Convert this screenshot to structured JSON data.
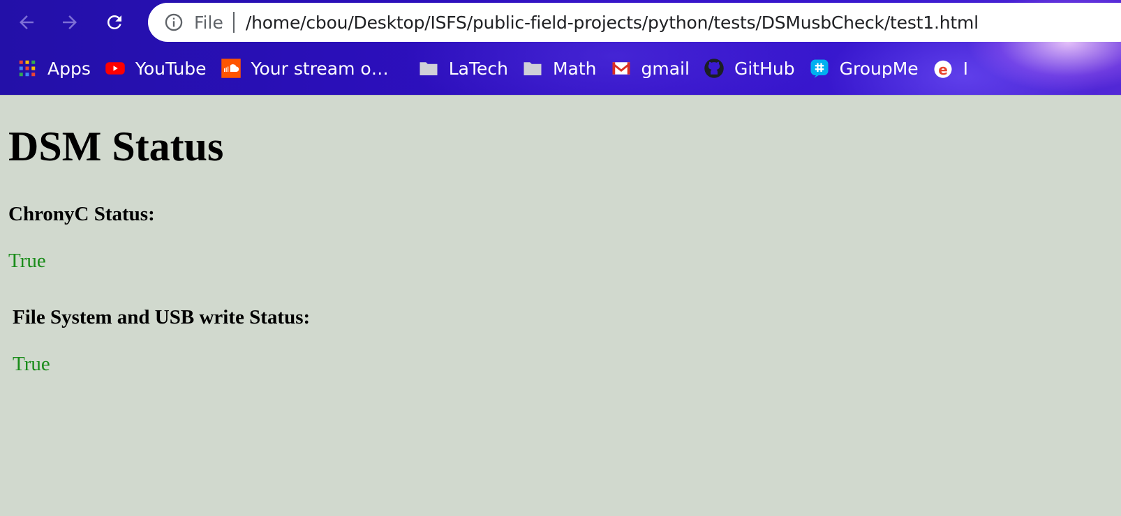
{
  "browser": {
    "back_icon": "arrow-left-icon",
    "forward_icon": "arrow-right-icon",
    "reload_icon": "reload-icon",
    "omnibox": {
      "info_icon": "info-icon",
      "scheme_label": "File",
      "url": "/home/cbou/Desktop/ISFS/public-field-projects/python/tests/DSMusbCheck/test1.html"
    },
    "bookmarks": [
      {
        "label": "Apps",
        "icon": "apps-grid-icon"
      },
      {
        "label": "YouTube",
        "icon": "youtube-icon"
      },
      {
        "label": "Your stream o…",
        "icon": "soundcloud-icon"
      },
      {
        "label": "LaTech",
        "icon": "folder-icon"
      },
      {
        "label": "Math",
        "icon": "folder-icon"
      },
      {
        "label": "gmail",
        "icon": "gmail-icon"
      },
      {
        "label": "GitHub",
        "icon": "github-icon"
      },
      {
        "label": "GroupMe",
        "icon": "groupme-icon"
      },
      {
        "label": "I",
        "icon": "edge-e-icon"
      }
    ]
  },
  "page": {
    "title": "DSM Status",
    "sections": [
      {
        "heading": "ChronyC Status:",
        "value": "True"
      },
      {
        "heading": "File System and USB write Status:",
        "value": "True"
      }
    ]
  },
  "colors": {
    "page_background": "#d1d9ce",
    "status_true": "#1a8c1a",
    "chrome_background": "#2a0fb8"
  }
}
